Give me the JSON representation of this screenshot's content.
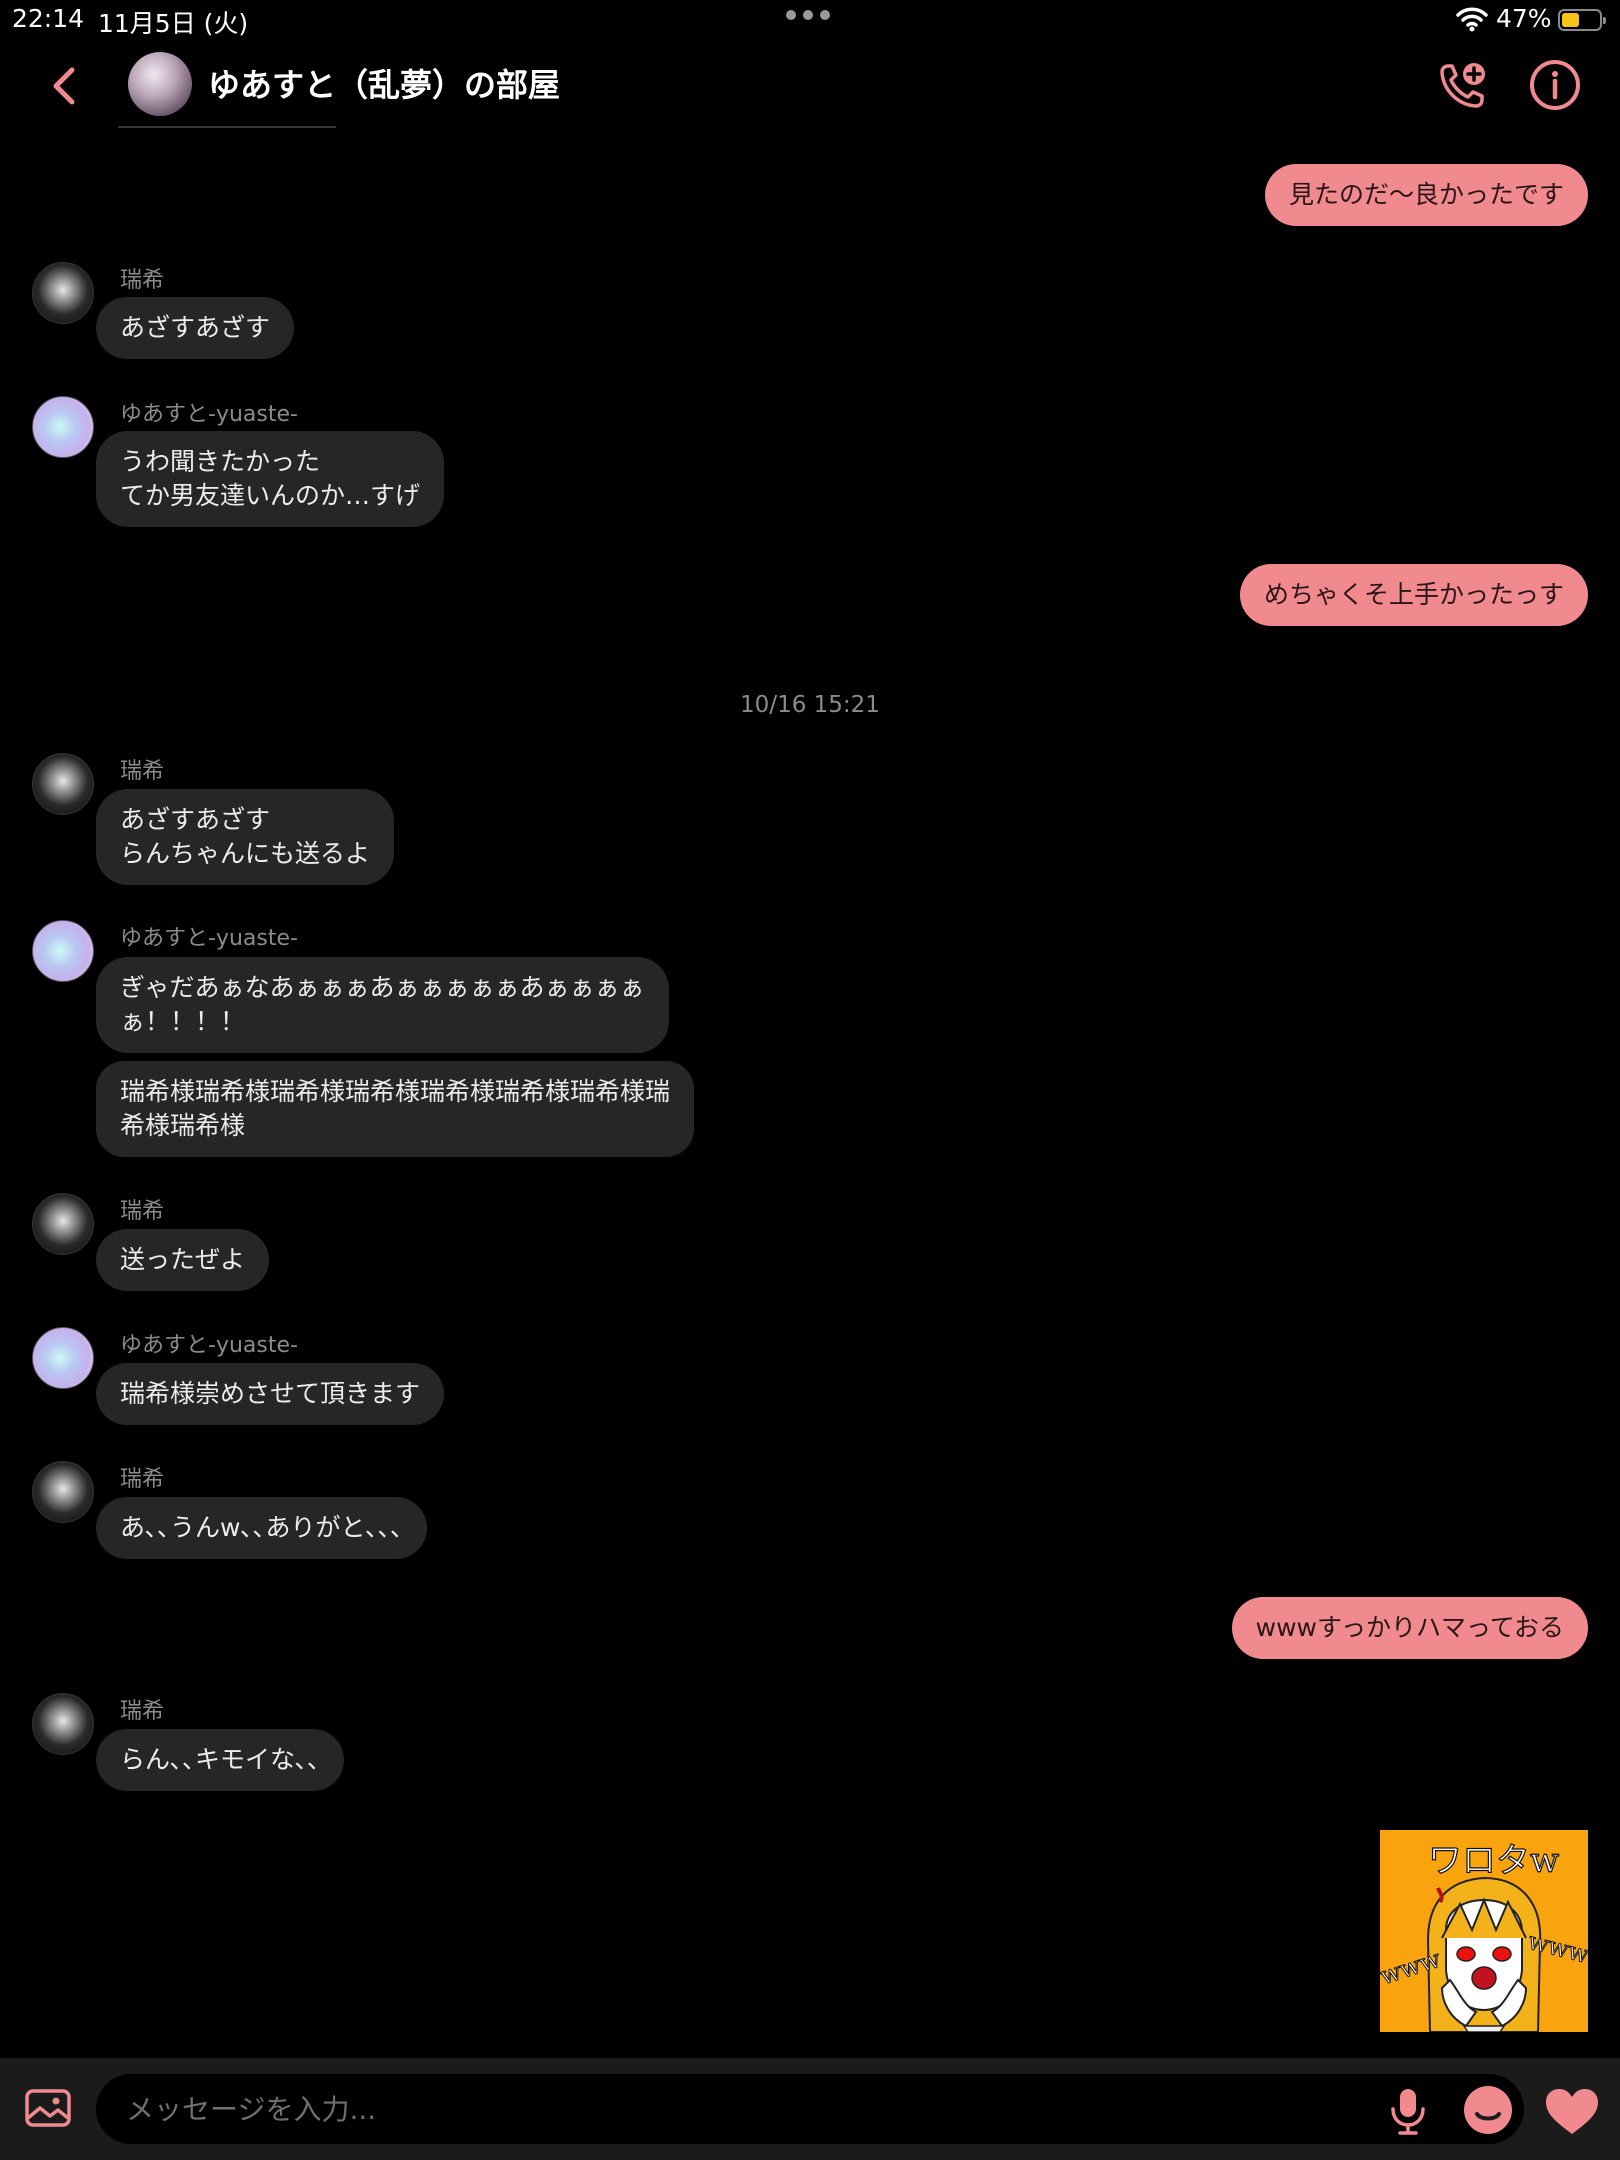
{
  "status_bar": {
    "time": "22:14",
    "date": "11月5日 (火)",
    "battery_pct": "47%",
    "battery_level": 0.47,
    "battery_color": "#f5c518"
  },
  "header": {
    "room_title": "ゆあすと（乱夢）の部屋",
    "icons": [
      "chevron-left-icon",
      "add-call-icon",
      "info-icon"
    ],
    "accent_color": "#f08a8f"
  },
  "messages": [
    {
      "side": "right",
      "text": "見たのだ〜良かったです"
    },
    {
      "side": "left",
      "sender": "瑞希",
      "text": "あざすあざす"
    },
    {
      "side": "left",
      "sender": "ゆあすと-yuaste-",
      "text": "うわ聞きたかった\nてか男友達いんのか…すげ"
    },
    {
      "side": "right",
      "text": "めちゃくそ上手かったっす"
    },
    {
      "side": "left",
      "sender": "瑞希",
      "text": "あざすあざす\nらんちゃんにも送るよ"
    },
    {
      "side": "left",
      "sender": "ゆあすと-yuaste-",
      "text": "ぎゃだあぁなあぁぁぁあぁぁぁぁぁあぁぁぁぁ\nぁ！！！！"
    },
    {
      "side": "left",
      "text": "瑞希様瑞希様瑞希様瑞希様瑞希様瑞希様瑞希様瑞\n希様瑞希様"
    },
    {
      "side": "left",
      "sender": "瑞希",
      "text": "送ったぜよ"
    },
    {
      "side": "left",
      "sender": "ゆあすと-yuaste-",
      "text": "瑞希様崇めさせて頂きます"
    },
    {
      "side": "left",
      "sender": "瑞希",
      "text": "あ､､うんw､､ありがと､､､"
    },
    {
      "side": "right",
      "text": "wwwすっかりハマっておる"
    },
    {
      "side": "left",
      "sender": "瑞希",
      "text": "らん､､キモイな､､"
    }
  ],
  "timestamp": "10/16 15:21",
  "sticker": {
    "text_top": "ワロタw",
    "text_left": "www",
    "text_right": "www",
    "bg_color": "#f9a30f"
  },
  "input": {
    "placeholder": "メッセージを入力...",
    "value": ""
  }
}
